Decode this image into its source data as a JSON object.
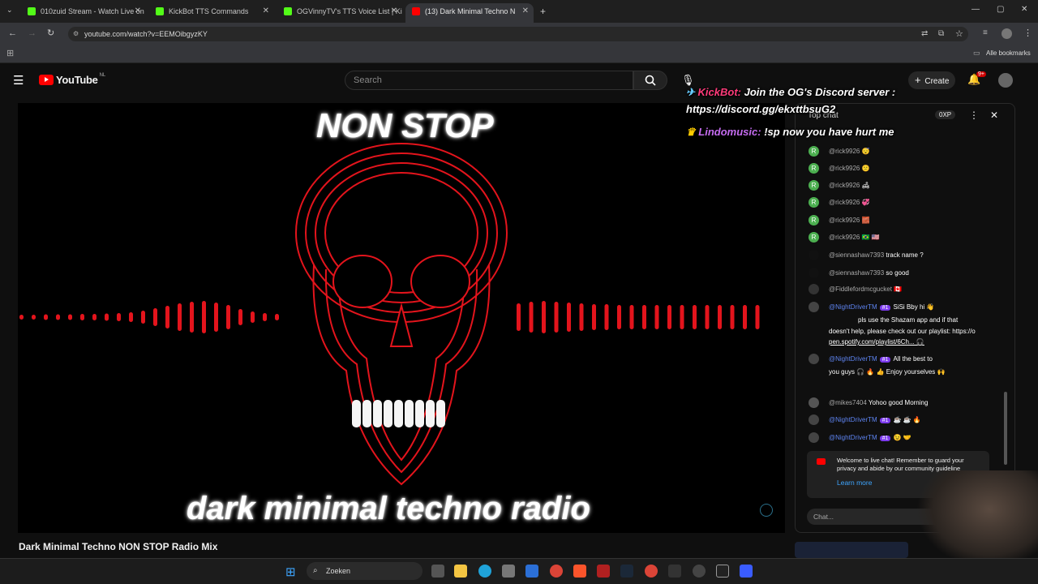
{
  "browser": {
    "tabs": [
      {
        "title": "010zuid Stream - Watch Live on",
        "icon_color": "#53fc18"
      },
      {
        "title": "KickBot TTS Commands",
        "icon_color": "#53fc18"
      },
      {
        "title": "OGVinnyTV's TTS Voice List | Ki",
        "icon_color": "#53fc18"
      },
      {
        "title": "(13) Dark Minimal Techno N",
        "icon_color": "#ff0000"
      }
    ],
    "new_tab_icon": "plus-icon",
    "url": "youtube.com/watch?v=EEMOibgyzKY",
    "bookmarks_label": "Alle bookmarks"
  },
  "youtube": {
    "logo_text": "YouTube",
    "region": "NL",
    "search_placeholder": "Search",
    "create_label": "Create",
    "notification_count": "9+"
  },
  "video": {
    "top_text": "NON STOP",
    "bottom_text": "dark minimal techno radio",
    "title": "Dark Minimal Techno NON STOP Radio Mix",
    "accent": "#e3141c"
  },
  "chat": {
    "header": "Top chat",
    "xp": "0XP",
    "overlay": [
      {
        "user": "KickBot:",
        "text": "Join the OG's Discord server :"
      },
      {
        "user": "",
        "text": "https://discord.gg/ekxttbsuG2"
      },
      {
        "user": "Lindomusic:",
        "text": "!sp now you have hurt me"
      }
    ],
    "messages": [
      {
        "author": "@rick9926",
        "text": "😴",
        "avatar": "R"
      },
      {
        "author": "@rick9926",
        "text": "😕",
        "avatar": "R"
      },
      {
        "author": "@rick9926",
        "text": "🛋",
        "avatar": "R"
      },
      {
        "author": "@rick9926",
        "text": "💞",
        "avatar": "R"
      },
      {
        "author": "@rick9926",
        "text": "🧱",
        "avatar": "R"
      },
      {
        "author": "@rick9926",
        "text": "🇧🇷 🇺🇸",
        "avatar": "R"
      },
      {
        "author": "@siennashaw7393",
        "text": "track name ?",
        "avatar": ""
      },
      {
        "author": "@siennashaw7393",
        "text": "so good",
        "avatar": ""
      },
      {
        "author": "@Fiddlefordmcgucket",
        "text": "🇨🇦",
        "avatar": ""
      },
      {
        "author": "@NightDriverTM",
        "badge": "#1",
        "text": "SiSi Bby hi 👋",
        "avatar": ""
      },
      {
        "author": "",
        "text": "pls use the Shazam app and if that",
        "avatar": ""
      },
      {
        "author": "",
        "text": "doesn't help, please check out our playlist: https://o",
        "avatar": ""
      },
      {
        "author": "",
        "text": "pen.spotify.com/playlist/6Ch... 🎧",
        "avatar": ""
      },
      {
        "author": "@NightDriverTM",
        "badge": "#1",
        "text": "All the best to",
        "avatar": ""
      },
      {
        "author": "",
        "text": "you guys 🎧 🔥 👍  Enjoy yourselves 🙌",
        "avatar": ""
      },
      {
        "author": "@mikes7404",
        "text": "Yohoo good Morning",
        "avatar": ""
      },
      {
        "author": "@NightDriverTM",
        "badge": "#1",
        "text": "☕ ☕ 🔥",
        "avatar": ""
      },
      {
        "author": "@NightDriverTM",
        "badge": "#1",
        "text": "😉 🤝",
        "avatar": ""
      }
    ],
    "welcome_text_1": "Welcome to live chat! Remember to guard your",
    "welcome_text_2": "privacy and abide by our community guideline",
    "learn_more": "Learn more",
    "input_placeholder": "Chat..."
  },
  "taskbar": {
    "search_label": "Zoeken"
  }
}
